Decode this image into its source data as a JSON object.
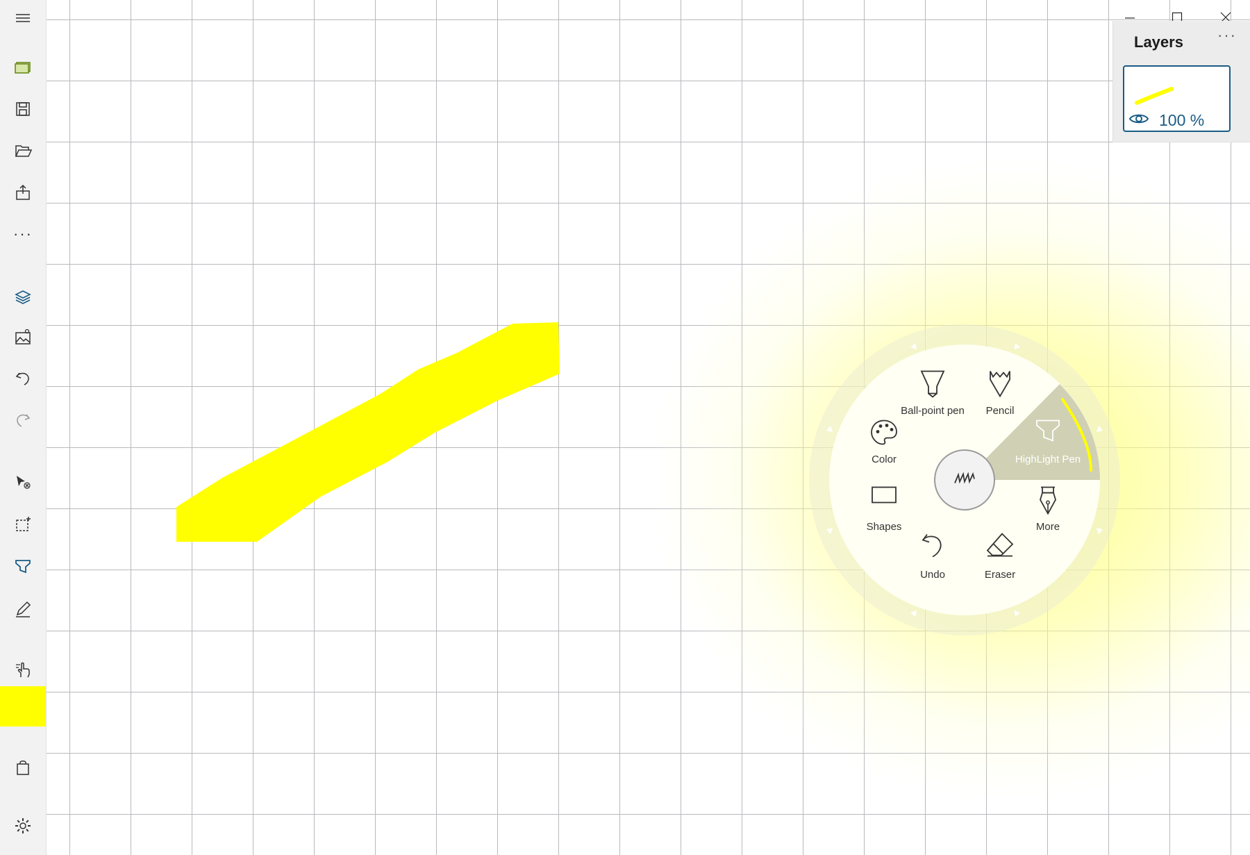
{
  "layers": {
    "title": "Layers",
    "more": "···",
    "layer1": {
      "opacity": "100 %"
    }
  },
  "radial_menu": {
    "items": [
      {
        "label": "Ball-point pen",
        "icon": "ballpoint-pen-icon"
      },
      {
        "label": "Pencil",
        "icon": "pencil-icon"
      },
      {
        "label": "HighLight Pen",
        "icon": "highlight-pen-icon",
        "selected": true
      },
      {
        "label": "Color",
        "icon": "palette-icon"
      },
      {
        "label": "Shapes",
        "icon": "rectangle-icon"
      },
      {
        "label": "More",
        "icon": "fountain-pen-icon"
      },
      {
        "label": "Undo",
        "icon": "undo-icon"
      },
      {
        "label": "Eraser",
        "icon": "eraser-icon"
      }
    ],
    "center_icon": "ink-scribble-icon"
  },
  "toolbar": {
    "items": [
      "hamburger-menu-icon",
      "new-canvas-icon",
      "save-icon",
      "open-folder-icon",
      "share-icon",
      "more-icon",
      "layers-icon",
      "image-icon",
      "undo-icon",
      "redo-icon",
      "select-icon",
      "selection-add-icon",
      "highlighter-icon",
      "pen-icon",
      "touch-draw-icon",
      "store-bag-icon",
      "gear-icon"
    ],
    "more": "···"
  },
  "colors": {
    "ink": "#ffff00",
    "accent": "#1a5c85",
    "grid": "#b9b9be",
    "toolbar_bg": "#f2f2f2"
  }
}
